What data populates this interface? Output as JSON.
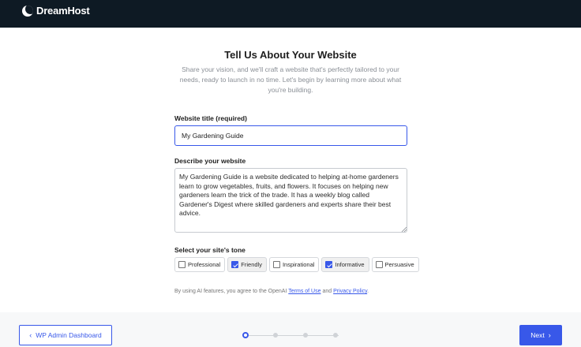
{
  "brand": {
    "name": "DreamHost"
  },
  "page": {
    "title": "Tell Us About Your Website",
    "subtitle": "Share your vision, and we'll craft a website that's perfectly tailored to your needs, ready to launch in no time. Let's begin by learning more about what you're building."
  },
  "form": {
    "title_label": "Website title (required)",
    "title_value": "My Gardening Guide",
    "description_label": "Describe your website",
    "description_value": "My Gardening Guide is a website dedicated to helping at-home gardeners learn to grow vegetables, fruits, and flowers. It focuses on helping new gardeners learn the trick of the trade. It has a weekly blog called Gardener's Digest where skilled gardeners and experts share their best advice.",
    "tone_label": "Select your site's tone",
    "tones": [
      {
        "label": "Professional",
        "checked": false
      },
      {
        "label": "Friendly",
        "checked": true
      },
      {
        "label": "Inspirational",
        "checked": false
      },
      {
        "label": "Informative",
        "checked": true
      },
      {
        "label": "Persuasive",
        "checked": false
      }
    ]
  },
  "disclaimer": {
    "prefix": "By using AI features, you agree to the OpenAI",
    "terms": "Terms of Use",
    "and": "and",
    "privacy": "Privacy Policy",
    "suffix": "."
  },
  "footer": {
    "back_label": "WP Admin Dashboard",
    "back_icon": "chevron-left-icon",
    "next_label": "Next",
    "next_icon": "chevron-right-icon",
    "steps_total": 4,
    "current_step": 1
  },
  "colors": {
    "topbar": "#0e1a24",
    "accent": "#3858e9"
  }
}
